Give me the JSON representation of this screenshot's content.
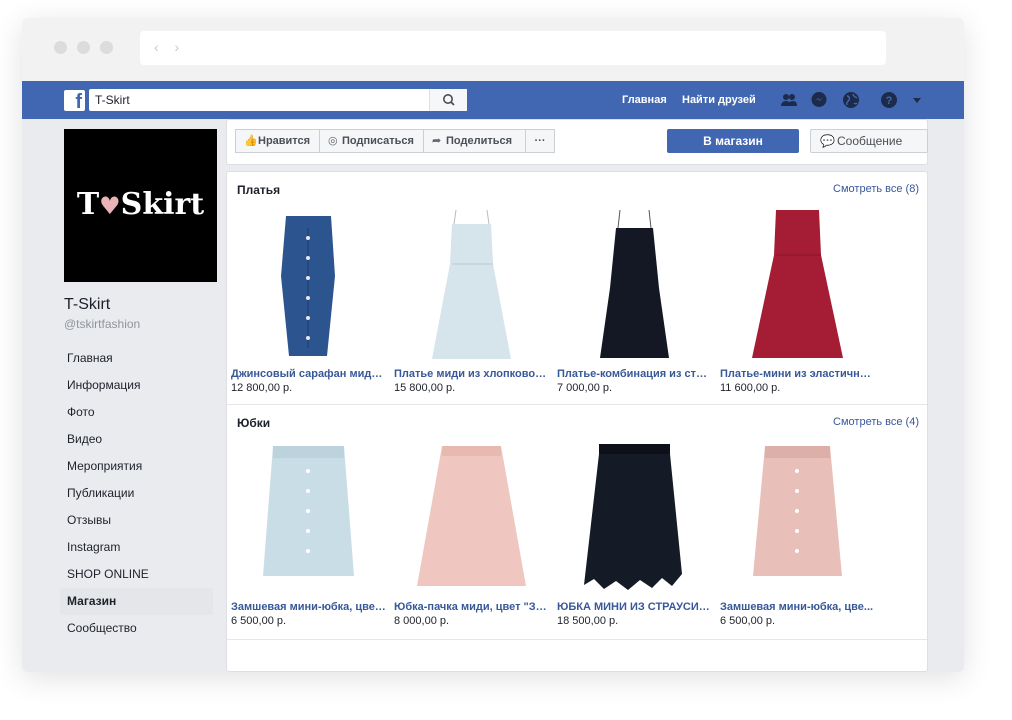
{
  "browser": {
    "nav_arrows": "‹ ›"
  },
  "topbar": {
    "logo": "f",
    "search_value": "T-Skirt",
    "links": [
      "Главная",
      "Найти друзей"
    ]
  },
  "page": {
    "cover_logo_left": "T",
    "cover_logo_heart": "♥",
    "cover_logo_right": "Skirt",
    "name": "T-Skirt",
    "handle": "@tskirtfashion",
    "menu": [
      "Главная",
      "Информация",
      "Фото",
      "Видео",
      "Мероприятия",
      "Публикации",
      "Отзывы",
      "Instagram",
      "SHOP ONLINE",
      "Магазин",
      "Сообщество"
    ],
    "active_menu_index": 9
  },
  "actions": {
    "like": "Нравится",
    "follow": "Подписаться",
    "share": "Поделиться",
    "more": "···",
    "shop": "В магазин",
    "message": "Сообщение"
  },
  "sections": [
    {
      "title": "Платья",
      "see_all": "Смотреть все (8)",
      "products": [
        {
          "title": "Джинсовый сарафан миди, ...",
          "price": "12 800,00 р.",
          "color": "#2c5590"
        },
        {
          "title": "Платье миди из хлопкового...",
          "price": "15 800,00 р.",
          "color": "#d6e4ec"
        },
        {
          "title": "Платье-комбинация из стру...",
          "price": "7 000,00 р.",
          "color": "#141824"
        },
        {
          "title": "Платье-мини из эластично...",
          "price": "11 600,00 р.",
          "color": "#a51c35"
        }
      ]
    },
    {
      "title": "Юбки",
      "see_all": "Смотреть все (4)",
      "products": [
        {
          "title": "Замшевая мини-юбка, цвет...",
          "price": "6 500,00 р.",
          "color": "#c9dde6"
        },
        {
          "title": "Юбка-пачка миди, цвет \"Зе...",
          "price": "8 000,00 р.",
          "color": "#efc7c0"
        },
        {
          "title": "ЮБКА МИНИ ИЗ СТРАУСИН...",
          "price": "18 500,00 р.",
          "color": "#151a27"
        },
        {
          "title": "Замшевая мини-юбка, цве...",
          "price": "6 500,00 р.",
          "color": "#e8bfb9"
        }
      ]
    }
  ]
}
